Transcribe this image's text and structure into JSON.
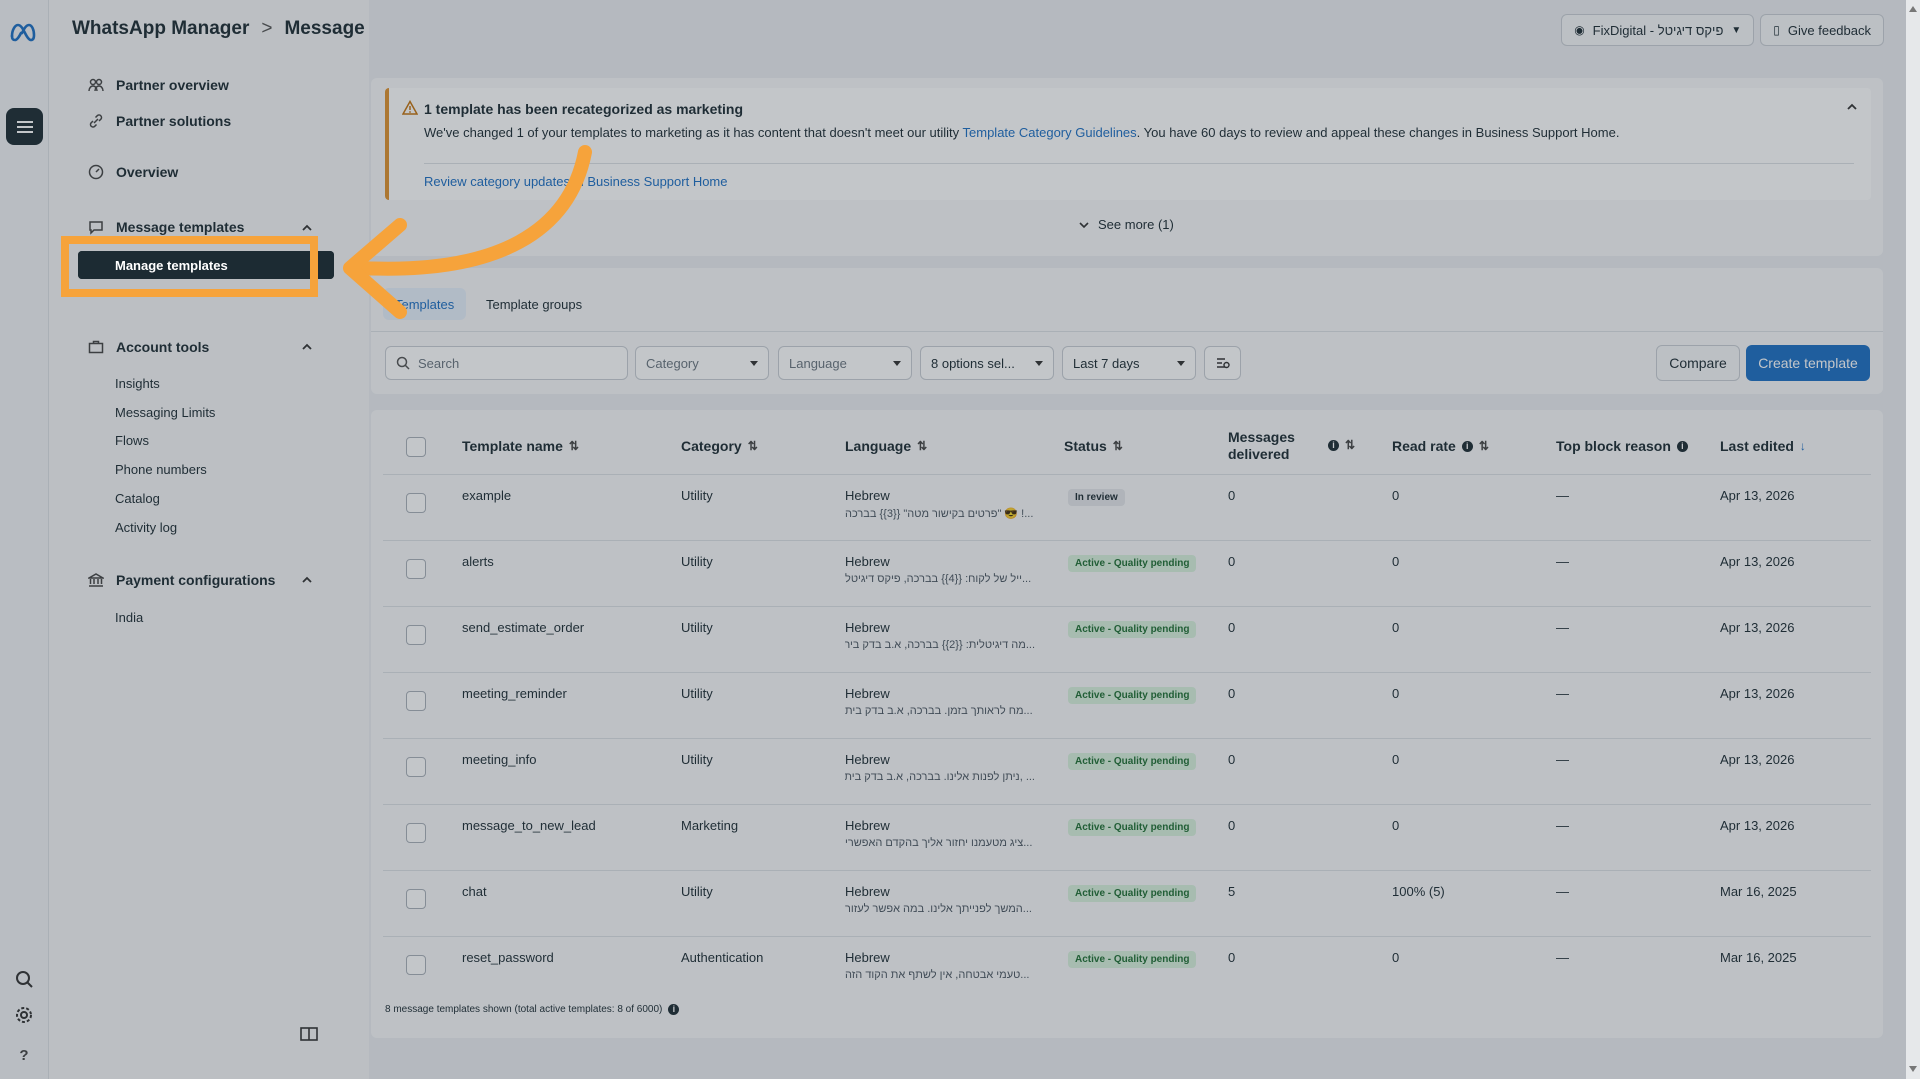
{
  "app": {
    "brand": "WhatsApp Manager",
    "page": "Message templates"
  },
  "top": {
    "account_label": "FixDigital - פיקס דיגיטל",
    "feedback_label": "Give feedback"
  },
  "sidebar": {
    "partner_overview": "Partner overview",
    "partner_solutions": "Partner solutions",
    "overview": "Overview",
    "message_templates": "Message templates",
    "manage_templates": "Manage templates",
    "account_tools": "Account tools",
    "account_items": [
      "Insights",
      "Messaging Limits",
      "Flows",
      "Phone numbers",
      "Catalog",
      "Activity log"
    ],
    "payment_configurations": "Payment configurations",
    "payment_items": [
      "India"
    ]
  },
  "banner": {
    "title": "1 template has been recategorized as marketing",
    "desc_before": "We've changed 1 of your templates to marketing as it has content that doesn't meet our utility ",
    "desc_link": "Template Category Guidelines",
    "desc_after": ". You have 60 days to review and appeal these changes in Business Support Home.",
    "review_link": "Review category updates in Business Support Home",
    "see_more": "See more (1)"
  },
  "tabs": [
    "Templates",
    "Template groups"
  ],
  "filters": {
    "search_placeholder": "Search",
    "category": "Category",
    "language": "Language",
    "status": "8 options sel...",
    "date": "Last 7 days"
  },
  "actions": {
    "compare": "Compare",
    "create": "Create template"
  },
  "columns": {
    "name": "Template name",
    "category": "Category",
    "language": "Language",
    "status": "Status",
    "messages_delivered_1": "Messages",
    "messages_delivered_2": "delivered",
    "read_rate": "Read rate",
    "top_block_reason": "Top block reason",
    "last_edited": "Last edited"
  },
  "rows": [
    {
      "name": "example",
      "category": "Utility",
      "language": "Hebrew",
      "preview": "...! 😎 \"פרטים בקישור מטה\" {{3}} בברכה",
      "status": "In review",
      "status_type": "review",
      "delivered": "0",
      "read_rate": "0",
      "block": "—",
      "edited": "Apr 13, 2026"
    },
    {
      "name": "alerts",
      "category": "Utility",
      "language": "Hebrew",
      "preview": "...ייל של לקוח: {{4}} בברכה, פיקס דיגיטל",
      "status": "Active - Quality pending",
      "status_type": "active",
      "delivered": "0",
      "read_rate": "0",
      "block": "—",
      "edited": "Apr 13, 2026"
    },
    {
      "name": "send_estimate_order",
      "category": "Utility",
      "language": "Hebrew",
      "preview": "...מה דיגיטלית: {{2}} בברכה, א.ב בדק בית",
      "status": "Active - Quality pending",
      "status_type": "active",
      "delivered": "0",
      "read_rate": "0",
      "block": "—",
      "edited": "Apr 13, 2026"
    },
    {
      "name": "meeting_reminder",
      "category": "Utility",
      "language": "Hebrew",
      "preview": "...מח לראותך בזמן. בברכה, א.ב בדק בית",
      "status": "Active - Quality pending",
      "status_type": "active",
      "delivered": "0",
      "read_rate": "0",
      "block": "—",
      "edited": "Apr 13, 2026"
    },
    {
      "name": "meeting_info",
      "category": "Utility",
      "language": "Hebrew",
      "preview": "... ,ניתן לפנות אלינו. בברכה, א.ב בדק בית",
      "status": "Active - Quality pending",
      "status_type": "active",
      "delivered": "0",
      "read_rate": "0",
      "block": "—",
      "edited": "Apr 13, 2026"
    },
    {
      "name": "message_to_new_lead",
      "category": "Marketing",
      "language": "Hebrew",
      "preview": "...ציג מטעמנו יחזור אליך בהקדם האפשרי",
      "status": "Active - Quality pending",
      "status_type": "active",
      "delivered": "0",
      "read_rate": "0",
      "block": "—",
      "edited": "Apr 13, 2026"
    },
    {
      "name": "chat",
      "category": "Utility",
      "language": "Hebrew",
      "preview": "...המשך לפנייתך אלינו. במה אפשר לעזור",
      "status": "Active - Quality pending",
      "status_type": "active",
      "delivered": "5",
      "read_rate": "100% (5)",
      "block": "—",
      "edited": "Mar 16, 2025"
    },
    {
      "name": "reset_password",
      "category": "Authentication",
      "language": "Hebrew",
      "preview": "...טעמי אבטחה, אין לשתף את הקוד הזה",
      "status": "Active - Quality pending",
      "status_type": "active",
      "delivered": "0",
      "read_rate": "0",
      "block": "—",
      "edited": "Mar 16, 2025"
    }
  ],
  "footer": "8 message templates shown (total active templates: 8 of 6000)",
  "colors": {
    "accent": "#1d6fc4",
    "highlight": "#f6a33b",
    "dark": "#1c2b33"
  }
}
